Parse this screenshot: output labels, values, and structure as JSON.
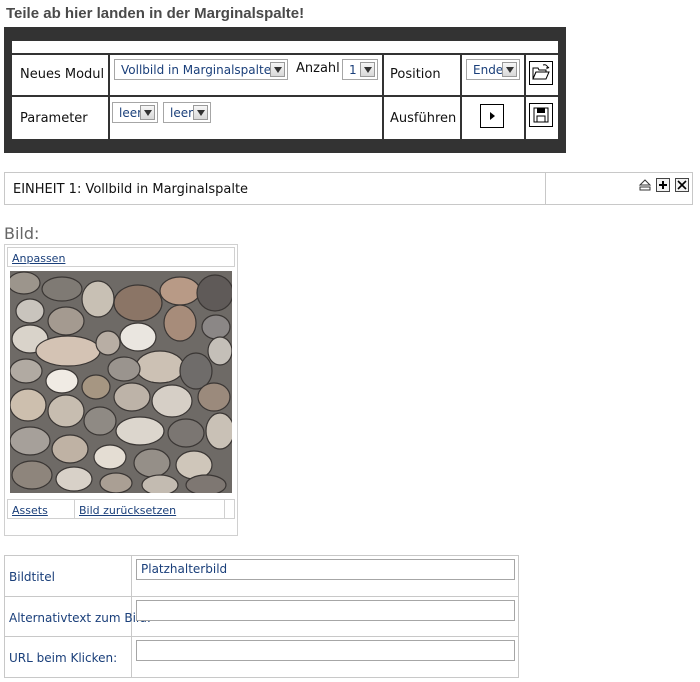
{
  "heading": "Teile ab hier landen in der Marginalspalte!",
  "module_panel": {
    "neues_modul_label": "Neues Modul",
    "module_select_value": "Vollbild in Marginalspalte",
    "anzahl_label": "Anzahl",
    "anzahl_value": "1",
    "position_label": "Position",
    "position_value": "Ende",
    "parameter_label": "Parameter",
    "param1_value": "leer",
    "param2_value": "leer",
    "ausfuehren_label": "Ausführen"
  },
  "unit": {
    "title": "EINHEIT 1: Vollbild in Marginalspalte"
  },
  "bild_label": "Bild:",
  "image_widget": {
    "anpassen": "Anpassen",
    "assets": "Assets",
    "reset": "Bild zurücksetzen"
  },
  "form": {
    "rows": [
      {
        "label": "Bildtitel",
        "value": "Platzhalterbild"
      },
      {
        "label": "Alternativtext zum Bild:",
        "value": ""
      },
      {
        "label": "URL beim Klicken:",
        "value": ""
      }
    ]
  },
  "colors": {
    "panel_border": "#333333",
    "link": "#1a3f7a"
  },
  "icons": [
    "chevron-down-icon",
    "open-folder-icon",
    "play-icon",
    "save-disk-icon",
    "move-up-icon",
    "plus-icon",
    "close-icon"
  ]
}
